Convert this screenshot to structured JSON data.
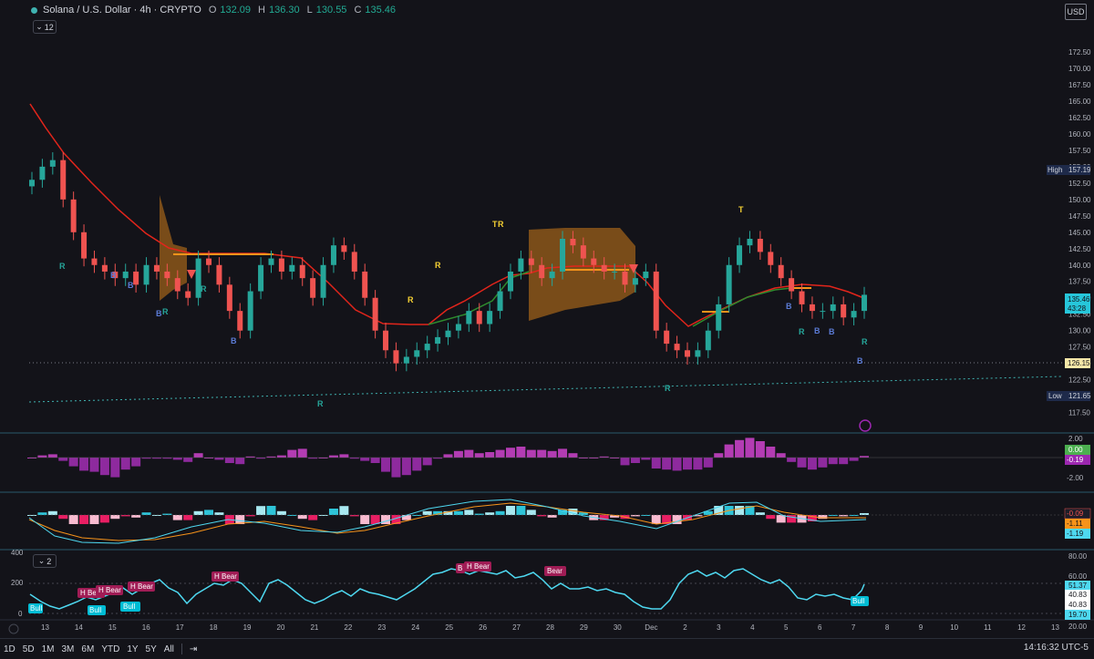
{
  "symbol": {
    "title": "Solana / U.S. Dollar · 4h · CRYPTO",
    "o_label": "O",
    "o": "132.09",
    "h_label": "H",
    "h": "136.30",
    "l_label": "L",
    "l": "130.55",
    "c_label": "C",
    "c": "135.46",
    "indicator_count": "12",
    "currency": "USD"
  },
  "colors": {
    "up": "#26a69a",
    "down": "#ef5350",
    "teal": "#3fb2b0",
    "red": "#e2251b",
    "orange": "#f7931a",
    "purple": "#9c27b0",
    "cyan": "#4ed8f0"
  },
  "price_axis": {
    "ticks": [
      "172.50",
      "170.00",
      "167.50",
      "165.00",
      "162.50",
      "160.00",
      "157.50",
      "155.00",
      "152.50",
      "150.00",
      "147.50",
      "145.00",
      "142.50",
      "140.00",
      "137.50",
      "135.00",
      "132.50",
      "130.00",
      "127.50",
      "125.00",
      "122.50",
      "120.00",
      "117.50"
    ],
    "high_label": "High",
    "high_value": "157.19",
    "low_label": "Low",
    "low_value": "121.65",
    "last_price": "135.46",
    "countdown": "43:28",
    "line_value": "126.15"
  },
  "pane2_axis": {
    "ticks": [
      "2.00",
      "-2.00"
    ],
    "badge_zero": "0.00",
    "badge_value": "-0.19"
  },
  "pane3_axis": {
    "badges": [
      "-0.09",
      "-1.11",
      "-1.19"
    ]
  },
  "pane4_axis": {
    "left_ticks": [
      "400",
      "200",
      "0"
    ],
    "right_ticks": [
      "80.00",
      "60.00",
      "40.83",
      "40.83",
      "20.00"
    ],
    "last_value": "51.37",
    "low_value": "19.70",
    "indicator_count": "2"
  },
  "time_axis": {
    "labels": [
      "13",
      "14",
      "15",
      "16",
      "17",
      "18",
      "19",
      "20",
      "21",
      "22",
      "23",
      "24",
      "25",
      "26",
      "27",
      "28",
      "29",
      "30",
      "Dec",
      "2",
      "3",
      "4",
      "5",
      "6",
      "7",
      "8",
      "9",
      "10",
      "11",
      "12",
      "13"
    ]
  },
  "bottom_bar": {
    "timeframes": [
      "1D",
      "5D",
      "1M",
      "3M",
      "6M",
      "YTD",
      "1Y",
      "5Y",
      "All"
    ],
    "clock": "14:16:32 UTC-5"
  },
  "chart_data": {
    "type": "candlestick",
    "symbol": "SOLUSD",
    "interval": "4h",
    "ylim": [
      115.5,
      175
    ],
    "last_close": 135.46,
    "closes_approx": [
      153,
      155,
      156,
      150,
      145,
      141,
      140,
      139,
      138,
      139,
      137,
      140,
      139,
      138,
      136,
      135,
      141,
      140,
      137,
      133,
      130,
      136,
      140,
      141,
      139,
      140,
      138,
      135,
      140,
      143,
      142,
      139,
      135,
      130,
      127,
      125,
      126,
      127,
      128,
      129,
      130,
      131,
      133,
      131,
      133,
      136,
      139,
      141,
      140,
      138,
      139,
      144,
      143,
      141,
      140,
      139,
      139,
      137,
      138,
      139,
      130,
      128,
      127,
      126,
      127,
      130,
      134,
      140,
      143,
      144,
      142,
      140,
      138,
      136,
      134,
      133,
      133,
      134,
      132,
      133,
      135.46
    ],
    "signal_labels": [
      "R",
      "B",
      "B",
      "R",
      "B",
      "R",
      "B",
      "R",
      "R",
      "T",
      "R",
      "R",
      "T",
      "R",
      "B",
      "R",
      "B",
      "B",
      "R",
      "B"
    ],
    "rsi_labels": [
      "Bull",
      "Bull",
      "H Bear",
      "H Bear",
      "Bull",
      "H Bear",
      "H Bear",
      "B",
      "H Bear",
      "Bear",
      "Bull"
    ]
  }
}
